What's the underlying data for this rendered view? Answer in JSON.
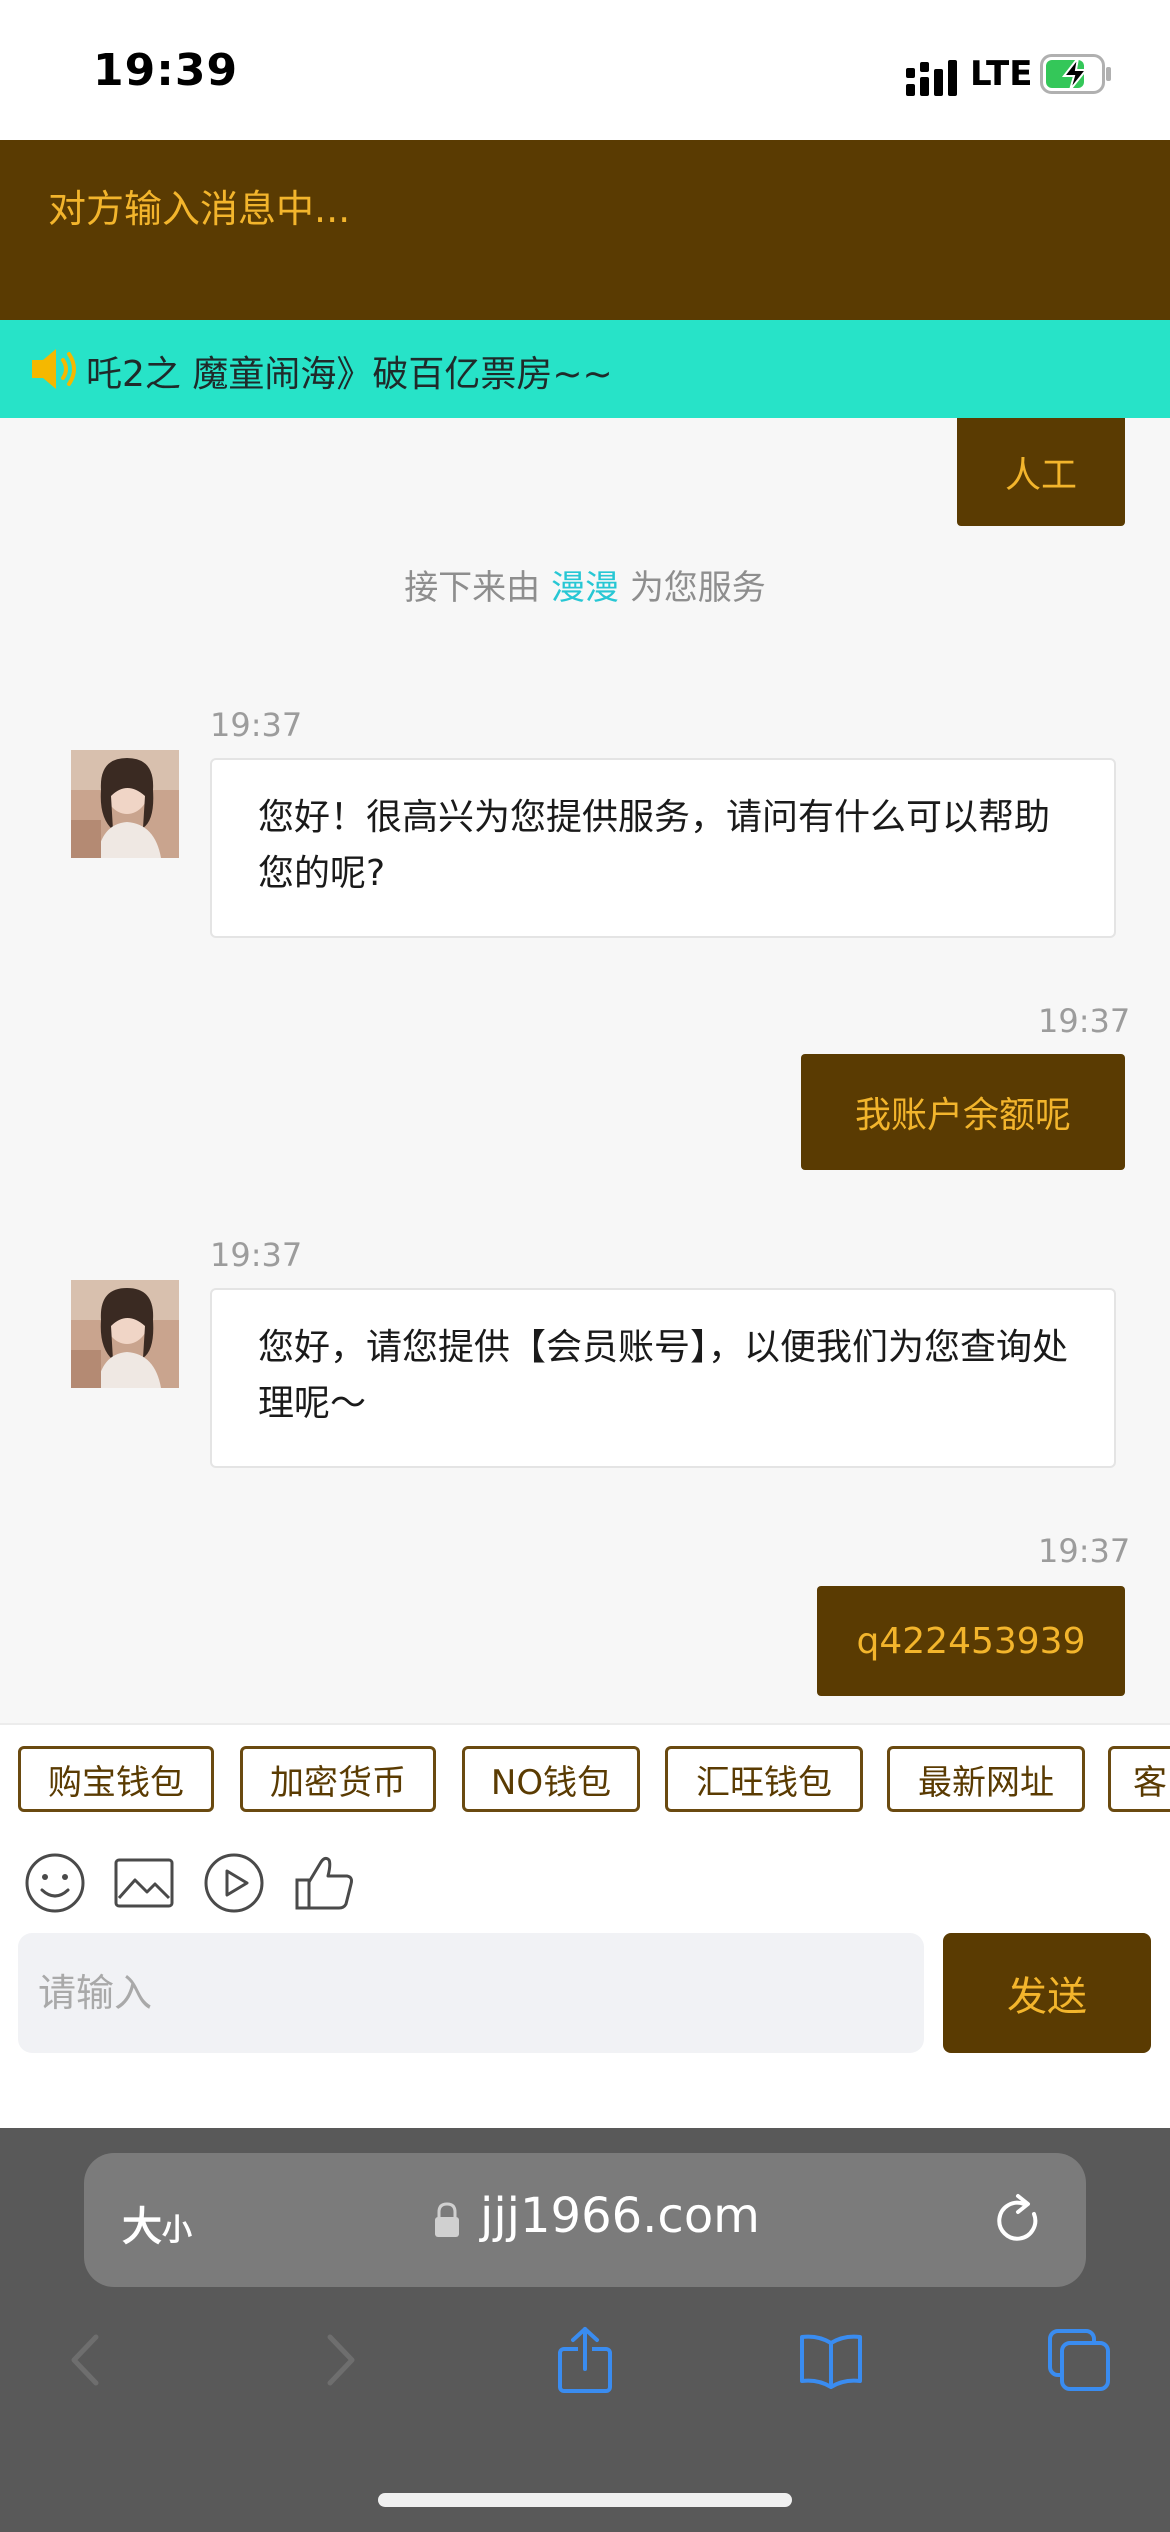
{
  "status_bar": {
    "time": "19:39",
    "network": "LTE"
  },
  "header": {
    "title": "对方输入消息中..."
  },
  "notice": {
    "text": "吒2之 魔童闹海》破百亿票房~~"
  },
  "chat": {
    "first_user_msg": "人工",
    "system_prefix": "接下来由",
    "agent_name": "漫漫",
    "system_suffix": "为您服务",
    "messages": [
      {
        "side": "left",
        "time": "19:37",
        "text": "您好！很高兴为您提供服务，请问有什么可以帮助您的呢?"
      },
      {
        "side": "right",
        "time": "19:37",
        "text": "我账户余额呢"
      },
      {
        "side": "left",
        "time": "19:37",
        "text": "您好，请您提供【会员账号】，以便我们为您查询处理呢～"
      },
      {
        "side": "right",
        "time": "19:37",
        "text": "q422453939"
      }
    ]
  },
  "quick_tags": [
    "购宝钱包",
    "加密货币",
    "NO钱包",
    "汇旺钱包",
    "最新网址",
    "客"
  ],
  "toolbar": {
    "icons": [
      "emoji-icon",
      "image-icon",
      "video-icon",
      "thumbs-up-icon"
    ]
  },
  "composer": {
    "placeholder": "请输入",
    "send_label": "发送"
  },
  "browser": {
    "text_size_big": "大",
    "text_size_small": "小",
    "url": "jjj1966.com"
  },
  "colors": {
    "brand": "#5a3b02",
    "accent": "#f3b52c",
    "notice": "#27e3c8",
    "agent_name": "#27c7d4"
  }
}
